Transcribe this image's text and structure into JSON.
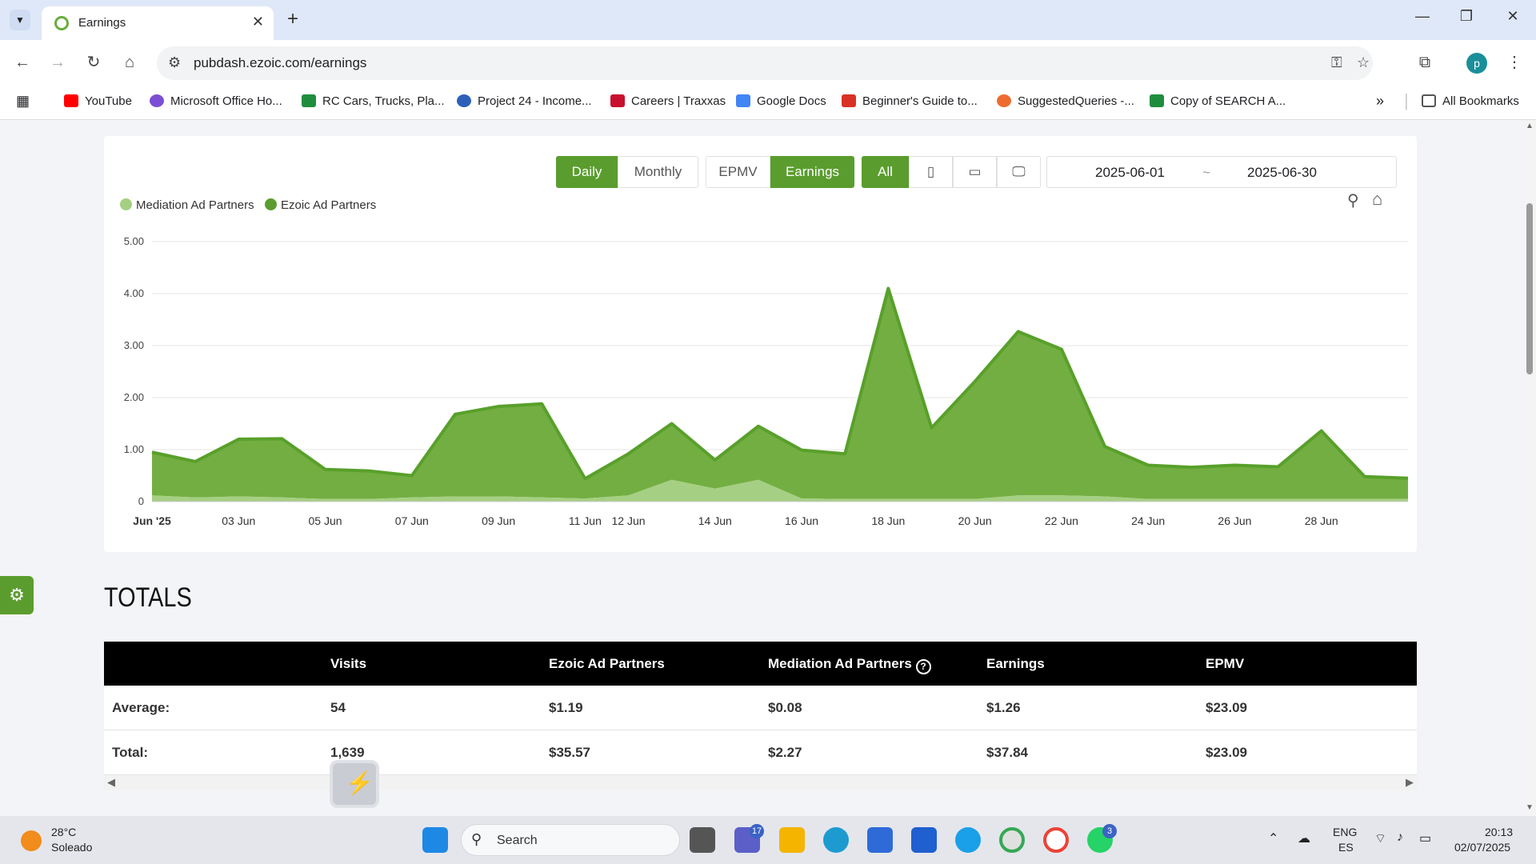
{
  "browser": {
    "tab_title": "Earnings",
    "url": "pubdash.ezoic.com/earnings",
    "avatar_letter": "p"
  },
  "bookmarks": [
    {
      "label": "YouTube",
      "color": "#ff0000"
    },
    {
      "label": "Microsoft Office Ho...",
      "color": "#7b4fd4"
    },
    {
      "label": "RC Cars, Trucks, Pla...",
      "color": "#1e8e3e"
    },
    {
      "label": "Project 24 - Income...",
      "color": "#2d5fb8"
    },
    {
      "label": "Careers | Traxxas",
      "color": "#c8102e"
    },
    {
      "label": "Google Docs",
      "color": "#4285f4"
    },
    {
      "label": "Beginner's Guide to...",
      "color": "#d93025"
    },
    {
      "label": "SuggestedQueries -...",
      "color": "#ee6b2f"
    },
    {
      "label": "Copy of SEARCH A...",
      "color": "#1e8e3e"
    }
  ],
  "all_bookmarks_label": "All Bookmarks",
  "controls": {
    "daily": "Daily",
    "monthly": "Monthly",
    "epmv": "EPMV",
    "earnings": "Earnings",
    "all": "All",
    "date_start": "2025-06-01",
    "date_sep": "~",
    "date_end": "2025-06-30"
  },
  "legend": {
    "mediation": "Mediation Ad Partners",
    "ezoic": "Ezoic Ad Partners"
  },
  "colors": {
    "accent": "#5a9d2e",
    "ezoic_fill": "#73ae42",
    "ezoic_line": "#58a02a",
    "mediation_fill": "#a5cf82"
  },
  "chart_data": {
    "type": "area",
    "stacked": true,
    "x": [
      "Jun '25",
      "02 Jun",
      "03 Jun",
      "04 Jun",
      "05 Jun",
      "06 Jun",
      "07 Jun",
      "08 Jun",
      "09 Jun",
      "10 Jun",
      "11 Jun",
      "12 Jun",
      "13 Jun",
      "14 Jun",
      "15 Jun",
      "16 Jun",
      "17 Jun",
      "18 Jun",
      "19 Jun",
      "20 Jun",
      "21 Jun",
      "22 Jun",
      "23 Jun",
      "24 Jun",
      "25 Jun",
      "26 Jun",
      "27 Jun",
      "28 Jun",
      "29 Jun",
      "30 Jun"
    ],
    "x_tick_labels": [
      "Jun '25",
      "03 Jun",
      "05 Jun",
      "07 Jun",
      "09 Jun",
      "11 Jun",
      "12 Jun",
      "14 Jun",
      "16 Jun",
      "18 Jun",
      "20 Jun",
      "22 Jun",
      "24 Jun",
      "26 Jun",
      "28 Jun"
    ],
    "x_tick_indices": [
      0,
      2,
      4,
      6,
      8,
      10,
      11,
      13,
      15,
      17,
      19,
      21,
      23,
      25,
      27
    ],
    "series": [
      {
        "name": "Mediation Ad Partners",
        "values": [
          0.12,
          0.08,
          0.1,
          0.08,
          0.05,
          0.05,
          0.08,
          0.1,
          0.1,
          0.08,
          0.06,
          0.12,
          0.42,
          0.25,
          0.42,
          0.06,
          0.05,
          0.05,
          0.05,
          0.05,
          0.12,
          0.12,
          0.1,
          0.05,
          0.05,
          0.05,
          0.05,
          0.05,
          0.05,
          0.05
        ]
      },
      {
        "name": "Ezoic Ad Partners",
        "values": [
          0.83,
          0.69,
          1.1,
          1.13,
          0.57,
          0.54,
          0.42,
          1.58,
          1.73,
          1.8,
          0.38,
          0.8,
          1.08,
          0.55,
          1.03,
          0.93,
          0.87,
          4.05,
          1.37,
          2.26,
          3.15,
          2.81,
          0.96,
          0.65,
          0.61,
          0.65,
          0.62,
          1.31,
          0.43,
          0.4
        ]
      }
    ],
    "y_ticks": [
      "5.00",
      "4.00",
      "3.00",
      "2.00",
      "1.00",
      "0"
    ],
    "ylim": [
      0,
      5
    ]
  },
  "totals": {
    "title": "TOTALS",
    "headers": [
      "Visits",
      "Ezoic Ad Partners",
      "Mediation Ad Partners",
      "Earnings",
      "EPMV"
    ],
    "rows": [
      {
        "label": "Average:",
        "values": [
          "54",
          "$1.19",
          "$0.08",
          "$1.26",
          "$23.09"
        ]
      },
      {
        "label": "Total:",
        "values": [
          "1,639",
          "$35.57",
          "$2.27",
          "$37.84",
          "$23.09"
        ]
      }
    ]
  },
  "taskbar": {
    "temp": "28°C",
    "weather": "Soleado",
    "search_placeholder": "Search",
    "teams_badge": "17",
    "whatsapp_badge": "3",
    "lang1": "ENG",
    "lang2": "ES",
    "time": "20:13",
    "date": "02/07/2025"
  }
}
